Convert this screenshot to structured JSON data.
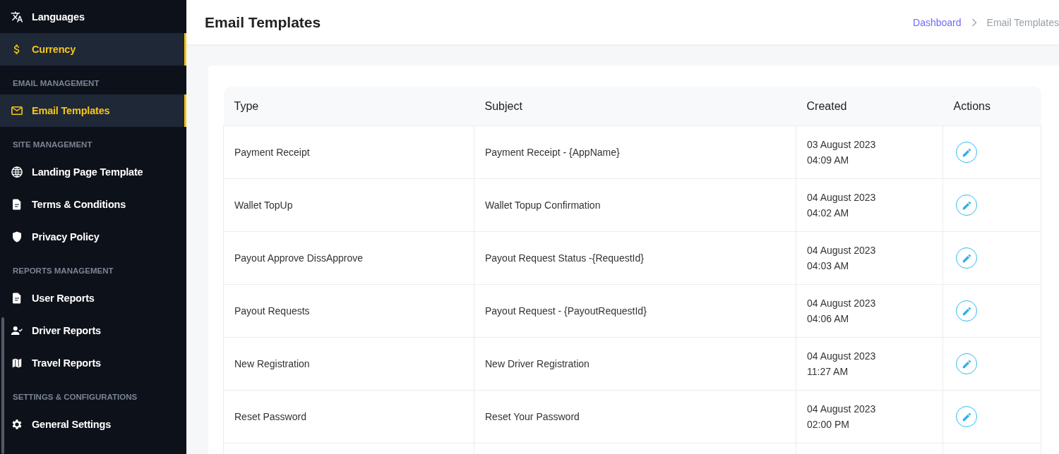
{
  "sidebar": {
    "entries": [
      {
        "kind": "item",
        "label": "Languages",
        "selected": false
      },
      {
        "kind": "item",
        "label": "Currency",
        "selected": true
      },
      {
        "kind": "section",
        "label": "EMAIL MANAGEMENT"
      },
      {
        "kind": "item",
        "label": "Email Templates",
        "selected": true
      },
      {
        "kind": "section",
        "label": "SITE MANAGEMENT"
      },
      {
        "kind": "item",
        "label": "Landing Page Template",
        "selected": false
      },
      {
        "kind": "item",
        "label": "Terms & Conditions",
        "selected": false
      },
      {
        "kind": "item",
        "label": "Privacy Policy",
        "selected": false
      },
      {
        "kind": "section",
        "label": "REPORTS MANAGEMENT"
      },
      {
        "kind": "item",
        "label": "User Reports",
        "selected": false
      },
      {
        "kind": "item",
        "label": "Driver Reports",
        "selected": false
      },
      {
        "kind": "item",
        "label": "Travel Reports",
        "selected": false
      },
      {
        "kind": "section",
        "label": "SETTINGS & CONFIGURATIONS"
      },
      {
        "kind": "item",
        "label": "General Settings",
        "selected": false
      }
    ]
  },
  "header": {
    "title": "Email Templates",
    "breadcrumb": [
      {
        "label": "Dashboard",
        "current": false
      },
      {
        "label": "Email Templates",
        "current": true
      }
    ]
  },
  "table": {
    "columns": [
      "Type",
      "Subject",
      "Created",
      "Actions"
    ],
    "rows": [
      {
        "type": "Payment Receipt",
        "subject": "Payment Receipt - {AppName}",
        "date": "03 August 2023",
        "time": "04:09 AM"
      },
      {
        "type": "Wallet TopUp",
        "subject": "Wallet Topup Confirmation",
        "date": "04 August 2023",
        "time": "04:02 AM"
      },
      {
        "type": "Payout Approve DissApprove",
        "subject": "Payout Request Status -{RequestId}",
        "date": "04 August 2023",
        "time": "04:03 AM"
      },
      {
        "type": "Payout Requests",
        "subject": "Payout Request - {PayoutRequestId}",
        "date": "04 August 2023",
        "time": "04:06 AM"
      },
      {
        "type": "New Registration",
        "subject": "New Driver Registration",
        "date": "04 August 2023",
        "time": "11:27 AM"
      },
      {
        "type": "Reset Password",
        "subject": "Reset Your Password",
        "date": "04 August 2023",
        "time": "02:00 PM"
      }
    ]
  }
}
